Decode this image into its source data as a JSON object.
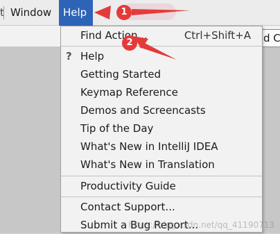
{
  "menubar": {
    "partial_item": "t",
    "window_label": "Window",
    "help_label": "Help"
  },
  "toolbar": {
    "add_config_partial": "d C"
  },
  "help_menu": {
    "items": [
      {
        "label": "Find Action...",
        "shortcut": "Ctrl+Shift+A"
      },
      {
        "label": "Help",
        "icon": "question-icon"
      },
      {
        "label": "Getting Started"
      },
      {
        "label": "Keymap Reference"
      },
      {
        "label": "Demos and Screencasts"
      },
      {
        "label": "Tip of the Day"
      },
      {
        "label": "What's New in IntelliJ IDEA"
      },
      {
        "label": "What's New in Translation"
      },
      {
        "label": "Productivity Guide"
      },
      {
        "label": "Contact Support..."
      },
      {
        "label": "Submit a Bug Report..."
      }
    ]
  },
  "annotations": {
    "step1": "1",
    "step2": "2",
    "color": "#e53a3a"
  },
  "watermark": "https://blog.csdn.net/qq_41190713"
}
